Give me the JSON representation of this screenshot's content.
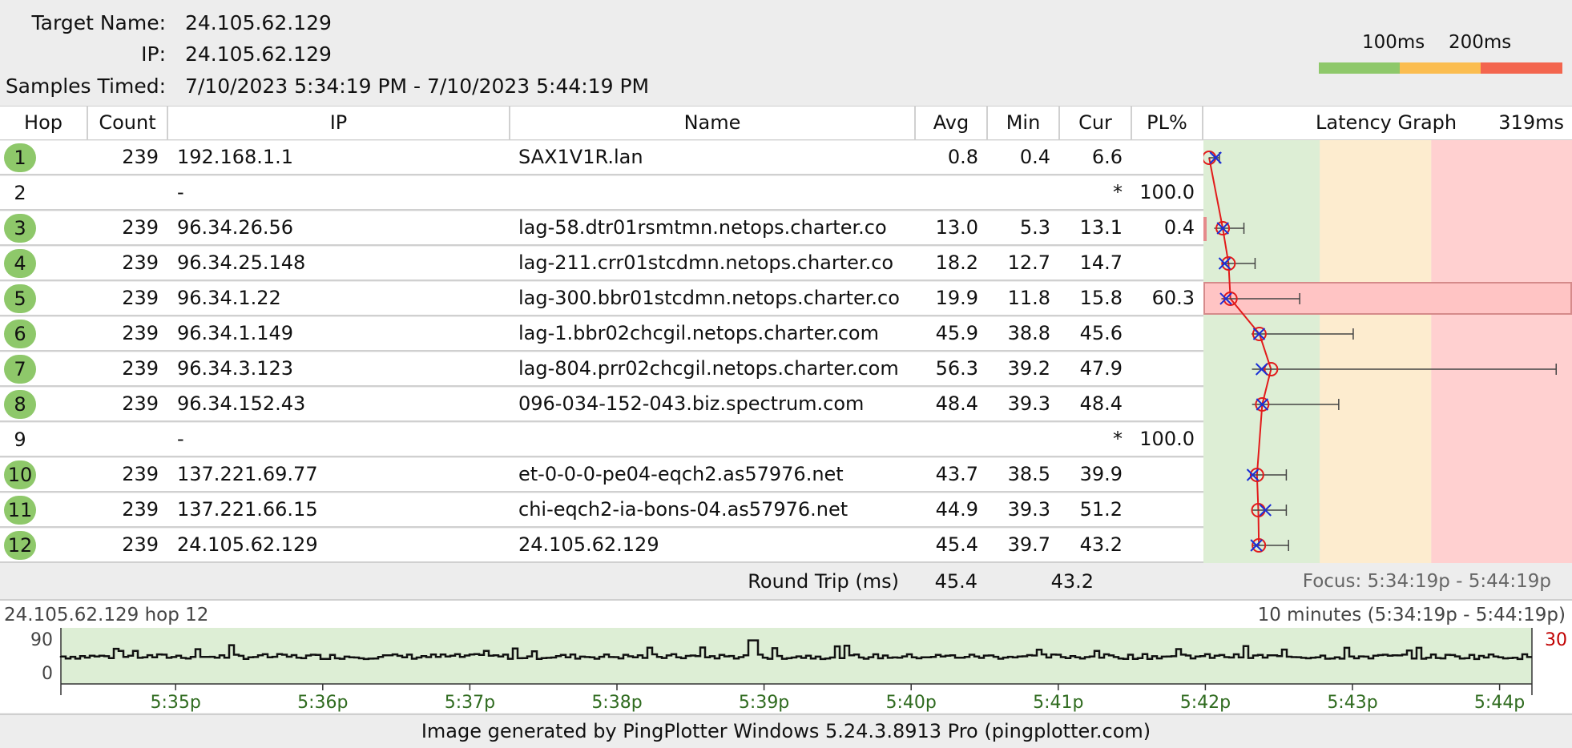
{
  "header": {
    "target_label": "Target Name:",
    "target_value": "24.105.62.129",
    "ip_label": "IP:",
    "ip_value": "24.105.62.129",
    "samples_label": "Samples Timed:",
    "samples_value": "7/10/2023 5:34:19 PM - 7/10/2023 5:44:19 PM"
  },
  "legend": {
    "low": "100ms",
    "high": "200ms"
  },
  "columns": {
    "hop": "Hop",
    "count": "Count",
    "ip": "IP",
    "name": "Name",
    "avg": "Avg",
    "min": "Min",
    "cur": "Cur",
    "pl": "PL%",
    "graph": "Latency Graph",
    "graph_max": "319ms"
  },
  "hops": [
    {
      "hop": "1",
      "count": "239",
      "ip": "192.168.1.1",
      "name": "SAX1V1R.lan",
      "avg": "0.8",
      "min": "0.4",
      "cur": "6.6",
      "pl": "",
      "ok": true
    },
    {
      "hop": "2",
      "count": "",
      "ip": "-",
      "name": "",
      "avg": "",
      "min": "",
      "cur": "*",
      "pl": "100.0",
      "ok": false
    },
    {
      "hop": "3",
      "count": "239",
      "ip": "96.34.26.56",
      "name": "lag-58.dtr01rsmtmn.netops.charter.co",
      "avg": "13.0",
      "min": "5.3",
      "cur": "13.1",
      "pl": "0.4",
      "ok": true
    },
    {
      "hop": "4",
      "count": "239",
      "ip": "96.34.25.148",
      "name": "lag-211.crr01stcdmn.netops.charter.co",
      "avg": "18.2",
      "min": "12.7",
      "cur": "14.7",
      "pl": "",
      "ok": true
    },
    {
      "hop": "5",
      "count": "239",
      "ip": "96.34.1.22",
      "name": "lag-300.bbr01stcdmn.netops.charter.co",
      "avg": "19.9",
      "min": "11.8",
      "cur": "15.8",
      "pl": "60.3",
      "ok": true
    },
    {
      "hop": "6",
      "count": "239",
      "ip": "96.34.1.149",
      "name": "lag-1.bbr02chcgil.netops.charter.com",
      "avg": "45.9",
      "min": "38.8",
      "cur": "45.6",
      "pl": "",
      "ok": true
    },
    {
      "hop": "7",
      "count": "239",
      "ip": "96.34.3.123",
      "name": "lag-804.prr02chcgil.netops.charter.com",
      "avg": "56.3",
      "min": "39.2",
      "cur": "47.9",
      "pl": "",
      "ok": true
    },
    {
      "hop": "8",
      "count": "239",
      "ip": "96.34.152.43",
      "name": "096-034-152-043.biz.spectrum.com",
      "avg": "48.4",
      "min": "39.3",
      "cur": "48.4",
      "pl": "",
      "ok": true
    },
    {
      "hop": "9",
      "count": "",
      "ip": "-",
      "name": "",
      "avg": "",
      "min": "",
      "cur": "*",
      "pl": "100.0",
      "ok": false
    },
    {
      "hop": "10",
      "count": "239",
      "ip": "137.221.69.77",
      "name": "et-0-0-0-pe04-eqch2.as57976.net",
      "avg": "43.7",
      "min": "38.5",
      "cur": "39.9",
      "pl": "",
      "ok": true
    },
    {
      "hop": "11",
      "count": "239",
      "ip": "137.221.66.15",
      "name": "chi-eqch2-ia-bons-04.as57976.net",
      "avg": "44.9",
      "min": "39.3",
      "cur": "51.2",
      "pl": "",
      "ok": true
    },
    {
      "hop": "12",
      "count": "239",
      "ip": "24.105.62.129",
      "name": "24.105.62.129",
      "avg": "45.4",
      "min": "39.7",
      "cur": "43.2",
      "pl": "",
      "ok": true
    }
  ],
  "latency_graph": {
    "scale_max_ms": 319,
    "hops": [
      {
        "avg": 0.8,
        "min": 0.4,
        "cur": 6.6,
        "max": 10,
        "pl": 0
      },
      null,
      {
        "avg": 13.0,
        "min": 5.3,
        "cur": 13.1,
        "max": 32,
        "pl": 0.4
      },
      {
        "avg": 18.2,
        "min": 12.7,
        "cur": 14.7,
        "max": 42,
        "pl": 0
      },
      {
        "avg": 19.9,
        "min": 11.8,
        "cur": 15.8,
        "max": 82,
        "pl": 60.3
      },
      {
        "avg": 45.9,
        "min": 38.8,
        "cur": 45.6,
        "max": 130,
        "pl": 0
      },
      {
        "avg": 56.3,
        "min": 39.2,
        "cur": 47.9,
        "max": 312,
        "pl": 0
      },
      {
        "avg": 48.4,
        "min": 39.3,
        "cur": 48.4,
        "max": 117,
        "pl": 0
      },
      null,
      {
        "avg": 43.7,
        "min": 38.5,
        "cur": 39.9,
        "max": 70,
        "pl": 0
      },
      {
        "avg": 44.9,
        "min": 39.3,
        "cur": 51.2,
        "max": 70,
        "pl": 0
      },
      {
        "avg": 45.4,
        "min": 39.7,
        "cur": 43.2,
        "max": 72,
        "pl": 0
      }
    ]
  },
  "round_trip": {
    "label": "Round Trip (ms)",
    "avg": "45.4",
    "cur": "43.2",
    "focus": "Focus: 5:34:19p - 5:44:19p"
  },
  "timeline": {
    "title": "24.105.62.129 hop 12",
    "range": "10 minutes (5:34:19p - 5:44:19p)",
    "y_top": "90",
    "y_bottom": "0",
    "right_value": "30",
    "ticks": [
      "5:35p",
      "5:36p",
      "5:37p",
      "5:38p",
      "5:39p",
      "5:40p",
      "5:41p",
      "5:42p",
      "5:43p",
      "5:44p"
    ]
  },
  "footer": "Image generated by PingPlotter Windows 5.24.3.8913 Pro (pingplotter.com)",
  "colors": {
    "green": "#8ec86a",
    "yellow": "#fbbd50",
    "red": "#f3654e",
    "zone_green": "#ddeed5",
    "zone_yellow": "#fdeccf",
    "zone_red": "#ffd0d0"
  }
}
